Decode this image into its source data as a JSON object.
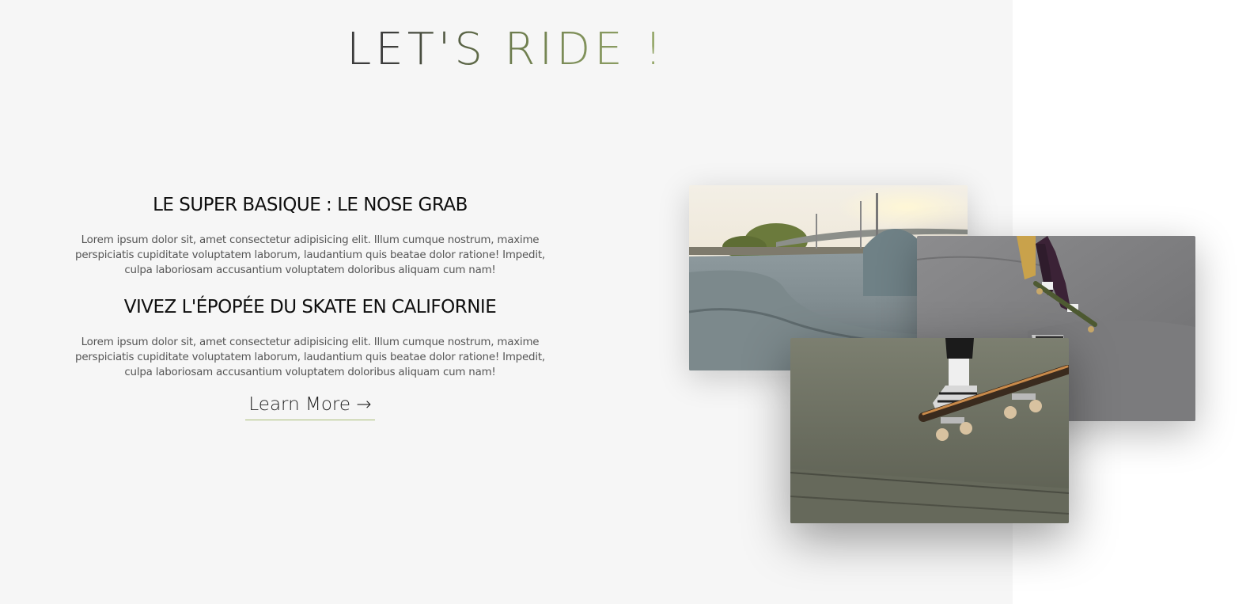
{
  "hero": {
    "title": "LET'S RIDE !"
  },
  "sections": [
    {
      "heading": "LE SUPER BASIQUE : LE NOSE GRAB",
      "text": "Lorem ipsum dolor sit, amet consectetur adipisicing elit. Illum cumque nostrum, maxime perspiciatis cupiditate voluptatem laborum, laudantium quis beatae dolor ratione! Impedit, culpa laboriosam accusantium voluptatem doloribus aliquam cum nam!"
    },
    {
      "heading": "VIVEZ L'ÉPOPÉE DU SKATE EN CALIFORNIE",
      "text": "Lorem ipsum dolor sit, amet consectetur adipisicing elit. Illum cumque nostrum, maxime perspiciatis cupiditate voluptatem laborum, laudantium quis beatae dolor ratione! Impedit, culpa laboriosam accusantium voluptatem doloribus aliquam cum nam!"
    }
  ],
  "cta": {
    "label": "Learn More →"
  },
  "colors": {
    "panel_background": "#f6f6f6",
    "accent_green": "#a9bd76",
    "title_dark": "#3b3b3b"
  },
  "images": [
    {
      "name": "skatepark-sunset-photo"
    },
    {
      "name": "skater-ramp-trick-photo"
    },
    {
      "name": "skateboard-ollie-photo"
    }
  ]
}
